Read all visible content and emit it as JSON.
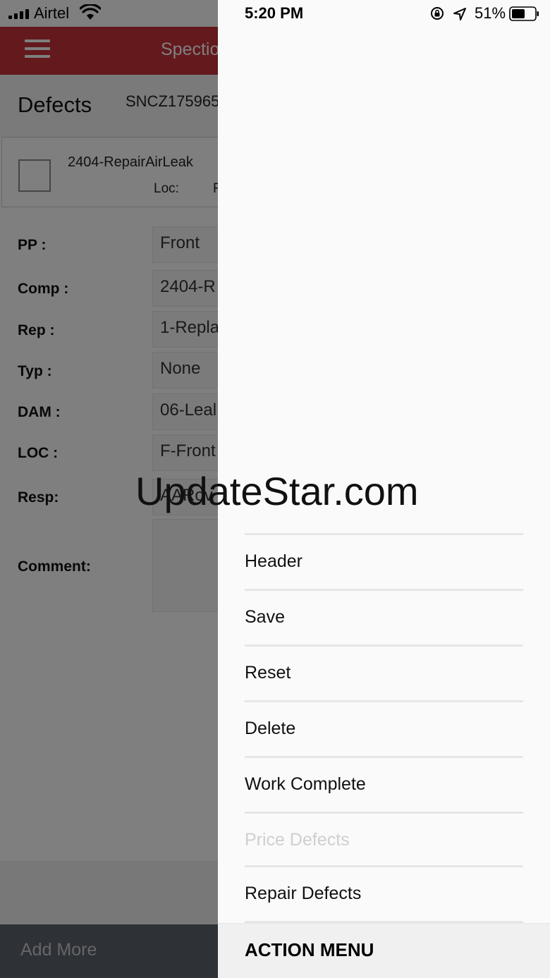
{
  "status_bar": {
    "carrier": "Airtel",
    "time": "5:20 PM",
    "battery_pct": "51%",
    "icons": [
      "signal-icon",
      "wifi-icon",
      "orientation-lock-icon",
      "location-icon",
      "battery-icon"
    ]
  },
  "app_bar": {
    "title": "Spectio"
  },
  "defects": {
    "title": "Defects",
    "code": "SNCZ175965",
    "item": {
      "name": "2404-RepairAirLeak",
      "loc_label": "Loc:",
      "loc_value": "F"
    }
  },
  "form": {
    "fields": [
      {
        "label": "PP :",
        "value": "Front"
      },
      {
        "label": "Comp :",
        "value": "2404-R"
      },
      {
        "label": "Rep :",
        "value": "1-Repla"
      },
      {
        "label": "Typ :",
        "value": "None"
      },
      {
        "label": "DAM :",
        "value": "06-Leal"
      },
      {
        "label": "LOC :",
        "value": "F-Front"
      },
      {
        "label": "Resp:",
        "value": "AARov"
      }
    ],
    "comment_label": "Comment:"
  },
  "footer": {
    "add_more": "Add More"
  },
  "menu": {
    "items": [
      {
        "label": "Header",
        "enabled": true
      },
      {
        "label": "Save",
        "enabled": true
      },
      {
        "label": "Reset",
        "enabled": true
      },
      {
        "label": "Delete",
        "enabled": true
      },
      {
        "label": "Work Complete",
        "enabled": true
      },
      {
        "label": "Price Defects",
        "enabled": false
      },
      {
        "label": "Repair Defects",
        "enabled": true
      }
    ],
    "footer_title": "ACTION MENU"
  },
  "watermark": "UpdateStar.com",
  "colors": {
    "app_bar": "#c8323a",
    "bottom_bar": "#5c626c",
    "drawer_bg": "#fafafa",
    "disabled_text": "#cfcfcf"
  }
}
